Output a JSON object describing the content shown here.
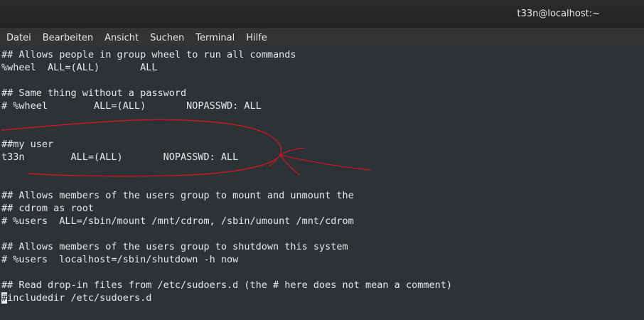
{
  "window": {
    "title": "t33n@localhost:~"
  },
  "menu": [
    "Datei",
    "Bearbeiten",
    "Ansicht",
    "Suchen",
    "Terminal",
    "Hilfe"
  ],
  "terminal": {
    "lines": [
      "## Allows people in group wheel to run all commands",
      "%wheel  ALL=(ALL)       ALL",
      "",
      "## Same thing without a password",
      "# %wheel        ALL=(ALL)       NOPASSWD: ALL",
      "",
      "",
      "##my user",
      "t33n        ALL=(ALL)       NOPASSWD: ALL",
      "",
      "",
      "## Allows members of the users group to mount and unmount the",
      "## cdrom as root",
      "# %users  ALL=/sbin/mount /mnt/cdrom, /sbin/umount /mnt/cdrom",
      "",
      "## Allows members of the users group to shutdown this system",
      "# %users  localhost=/sbin/shutdown -h now",
      "",
      "## Read drop-in files from /etc/sudoers.d (the # here does not mean a comment)"
    ],
    "last_line": {
      "cursor_char": "#",
      "rest": "includedir /etc/sudoers.d"
    }
  },
  "colors": {
    "background": "#2c3235",
    "text": "#e8e8e8",
    "annotation": "#e0141e"
  }
}
